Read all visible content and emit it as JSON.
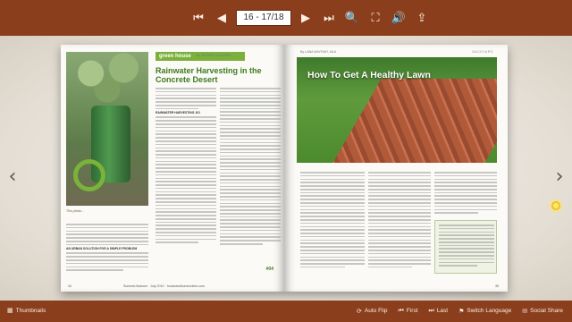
{
  "toolbar": {
    "page_indicator": "16 - 17/18",
    "icons": [
      "first-page-icon",
      "previous-page-icon",
      "next-page-icon",
      "last-page-icon",
      "zoom-icon",
      "fullscreen-icon",
      "sound-icon",
      "share-icon"
    ],
    "first_glyph": "⏮",
    "prev_glyph": "◀",
    "next_glyph": "▶",
    "last_glyph": "⏭",
    "zoom_glyph": "🔍",
    "full_glyph": "⛶",
    "sound_glyph": "🔊",
    "share_glyph": "⇪"
  },
  "left_page": {
    "section_label": "green house",
    "byline": "By JEFFREY HACKNEY",
    "title": "Rainwater Harvesting in the Concrete Desert",
    "photo_caption": "This photo...",
    "subhead_1": "RAINWATER HARVESTING 101",
    "subhead_2": "AN URBAN SOLUTION FOR A SIMPLE PROBLEM",
    "pull_quote": "Affect family ...",
    "page_number": "34",
    "footer_center": "Summer/Autumn · July 2010 · houseandhomeonline.com",
    "badge": "#04"
  },
  "right_page": {
    "byline": "By LANA MAYFAIR, MLA",
    "section": "BACKYARD",
    "hero_title": "How To Get A Healthy Lawn",
    "page_number": "35"
  },
  "nav": {
    "left_arrow": "‹",
    "right_arrow": "›"
  },
  "bottom": {
    "thumbnails": "Thumbnails",
    "auto_flip": "Auto Flip",
    "first": "First",
    "last": "Last",
    "switch_language": "Switch Language",
    "social_share": "Social Share",
    "thumb_glyph": "▦",
    "auto_glyph": "⟳",
    "first_glyph": "⏮",
    "last_glyph": "⏭",
    "lang_glyph": "⚑",
    "share_glyph": "✉"
  }
}
